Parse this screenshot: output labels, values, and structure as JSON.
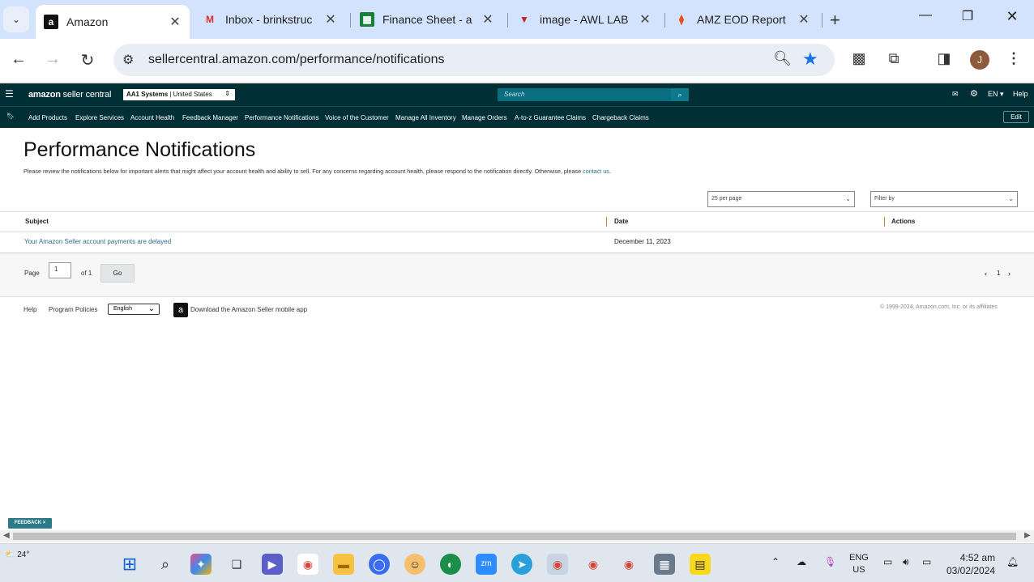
{
  "browser": {
    "tabs": [
      {
        "title": "Amazon",
        "favicon": "amazon-a",
        "active": true
      },
      {
        "title": "Inbox - brinkstruc",
        "favicon": "gmail-m"
      },
      {
        "title": "Finance Sheet - a",
        "favicon": "sheets"
      },
      {
        "title": "image - AWL LAB",
        "favicon": "awl"
      },
      {
        "title": "AMZ EOD Report",
        "favicon": "clickup"
      }
    ],
    "url": "sellercentral.amazon.com/performance/notifications",
    "profile_initial": "J"
  },
  "seller_header": {
    "logo_main": "amazon",
    "logo_sub": "seller central",
    "account_name": "AA1 Systems",
    "account_region": "United States",
    "search_placeholder": "Search",
    "lang": "EN",
    "help": "Help"
  },
  "nav": {
    "items": [
      "Add Products",
      "Explore Services",
      "Account Health",
      "Feedback Manager",
      "Performance Notifications",
      "Voice of the Customer",
      "Manage All Inventory",
      "Manage Orders",
      "A-to-z Guarantee Claims",
      "Chargeback Claims"
    ],
    "edit": "Edit"
  },
  "page": {
    "title": "Performance Notifications",
    "intro": "Please review the notifications below for important alerts that might affect your account health and ability to sell. For any concerns regarding account health, please respond to the notification directly. Otherwise, please ",
    "intro_link": "contact us",
    "intro_end": ".",
    "per_page": "25 per page",
    "filter_by": "Filter by",
    "columns": {
      "subject": "Subject",
      "date": "Date",
      "actions": "Actions"
    },
    "rows": [
      {
        "subject": "Your Amazon Seller account payments are delayed",
        "date": "December 11, 2023"
      }
    ],
    "pager": {
      "page_label": "Page",
      "page_value": "1",
      "of_label": "of 1",
      "go": "Go",
      "current": "1"
    }
  },
  "footer": {
    "help": "Help",
    "policies": "Program Policies",
    "language": "English",
    "app": "Download the Amazon Seller mobile app",
    "copyright": "© 1999-2024, Amazon.com, Inc. or its affiliates"
  },
  "feedback": "FEEDBACK ×",
  "taskbar": {
    "temperature": "24°",
    "lang_top": "ENG",
    "lang_bottom": "US",
    "time": "4:52 am",
    "date": "03/02/2024"
  }
}
